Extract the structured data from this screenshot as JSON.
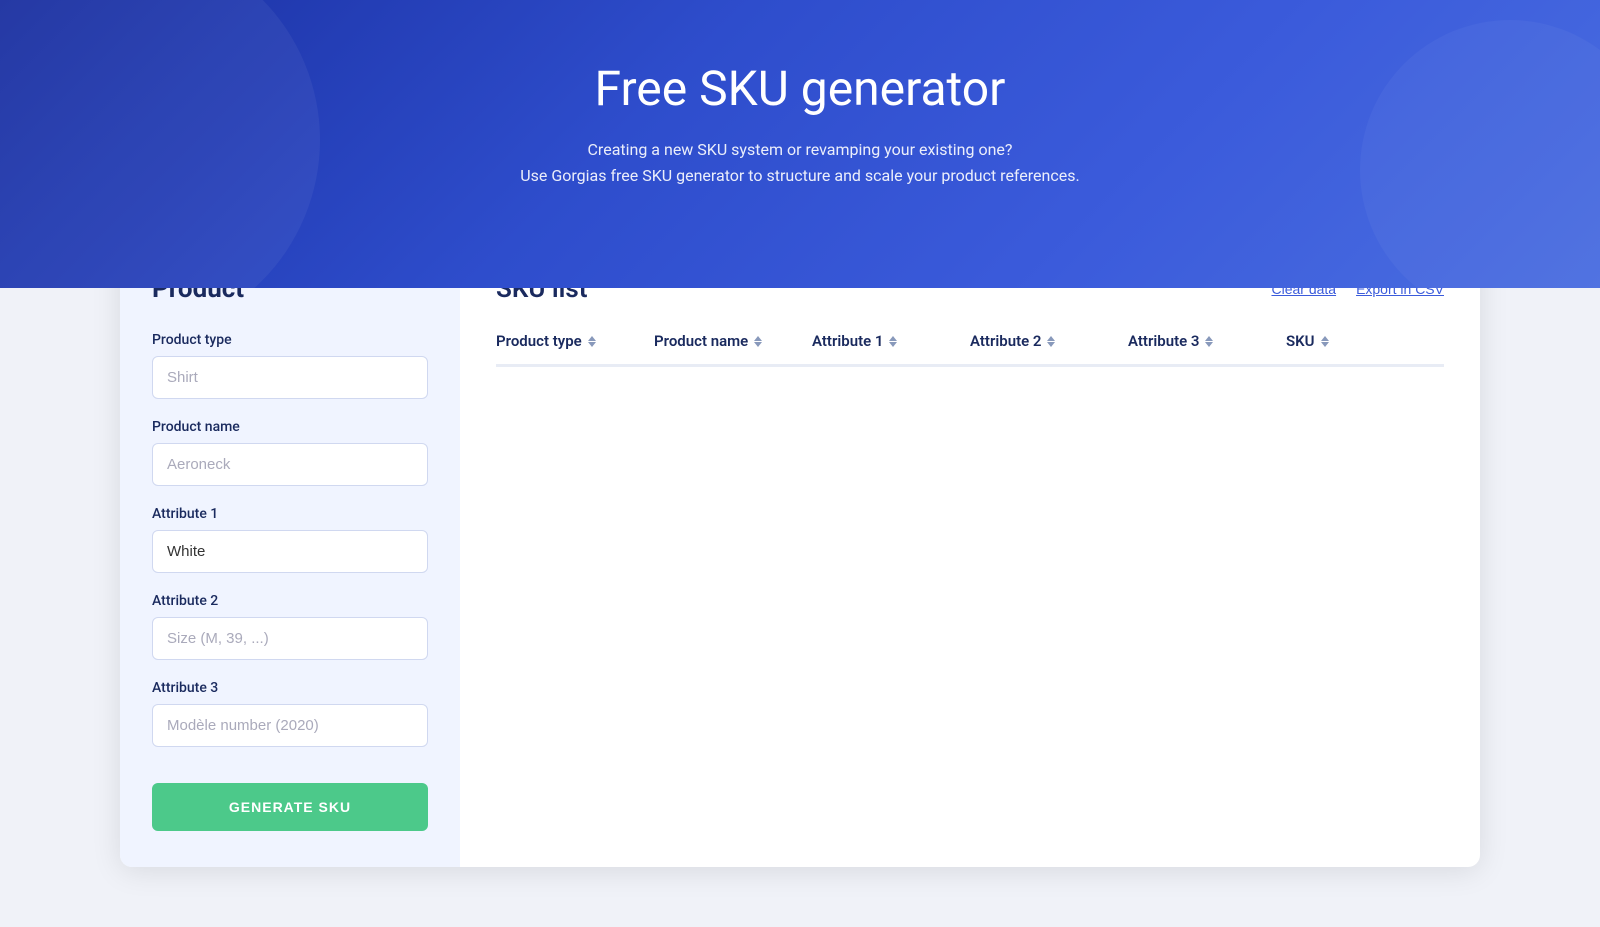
{
  "hero": {
    "title": "Free SKU generator",
    "subtitle_line1": "Creating a new SKU system or revamping your existing one?",
    "subtitle_line2": "Use Gorgias free SKU generator to structure and scale your product references."
  },
  "sidebar": {
    "title": "Product",
    "fields": [
      {
        "id": "product_type",
        "label": "Product type",
        "value": "",
        "placeholder": "Shirt"
      },
      {
        "id": "product_name",
        "label": "Product name",
        "value": "",
        "placeholder": "Aeroneck"
      },
      {
        "id": "attribute_1",
        "label": "Attribute 1",
        "value": "White",
        "placeholder": "White"
      },
      {
        "id": "attribute_2",
        "label": "Attribute 2",
        "value": "",
        "placeholder": "Size (M, 39, ...)"
      },
      {
        "id": "attribute_3",
        "label": "Attribute 3",
        "value": "",
        "placeholder": "Modèle number (2020)"
      }
    ],
    "generate_button": "GENERATE SKU"
  },
  "content": {
    "title": "SKU list",
    "clear_data_label": "Clear data",
    "export_csv_label": "Export in CSV",
    "table": {
      "columns": [
        {
          "id": "product_type",
          "label": "Product type"
        },
        {
          "id": "product_name",
          "label": "Product name"
        },
        {
          "id": "attribute_1",
          "label": "Attribute 1"
        },
        {
          "id": "attribute_2",
          "label": "Attribute 2"
        },
        {
          "id": "attribute_3",
          "label": "Attribute 3"
        },
        {
          "id": "sku",
          "label": "SKU"
        }
      ],
      "rows": []
    }
  }
}
